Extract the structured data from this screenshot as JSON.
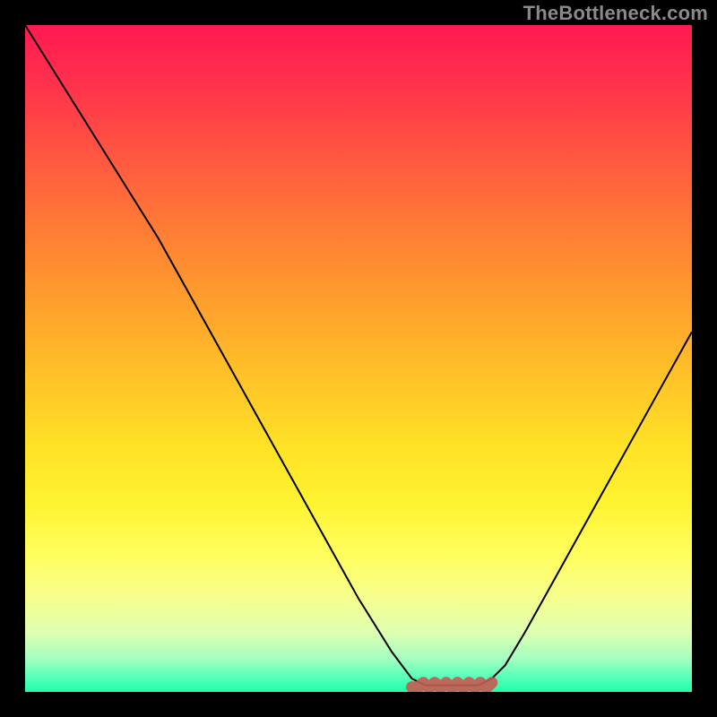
{
  "watermark": "TheBottleneck.com",
  "chart_data": {
    "type": "line",
    "title": "",
    "xlabel": "",
    "ylabel": "",
    "xlim": [
      0,
      100
    ],
    "ylim": [
      0,
      100
    ],
    "series": [
      {
        "name": "bottleneck-curve",
        "x": [
          0,
          5,
          10,
          15,
          20,
          25,
          30,
          35,
          40,
          45,
          50,
          55,
          58,
          60,
          62,
          65,
          68,
          70,
          72,
          75,
          80,
          85,
          90,
          95,
          100
        ],
        "values": [
          100,
          92,
          84,
          76,
          68,
          59,
          50,
          41,
          32,
          23,
          14,
          6,
          2,
          1,
          1,
          1,
          1,
          2,
          4,
          9,
          18,
          27,
          36,
          45,
          54
        ]
      }
    ],
    "annotations": [
      {
        "name": "valley-marker",
        "x_range": [
          58,
          70
        ],
        "y": 1
      }
    ],
    "background_gradient": {
      "top": "#ff1a52",
      "mid": "#ffe126",
      "bottom": "#1effac"
    },
    "colors": {
      "curve": "#000000",
      "valley": "#c85a52",
      "frame": "#000000"
    }
  }
}
